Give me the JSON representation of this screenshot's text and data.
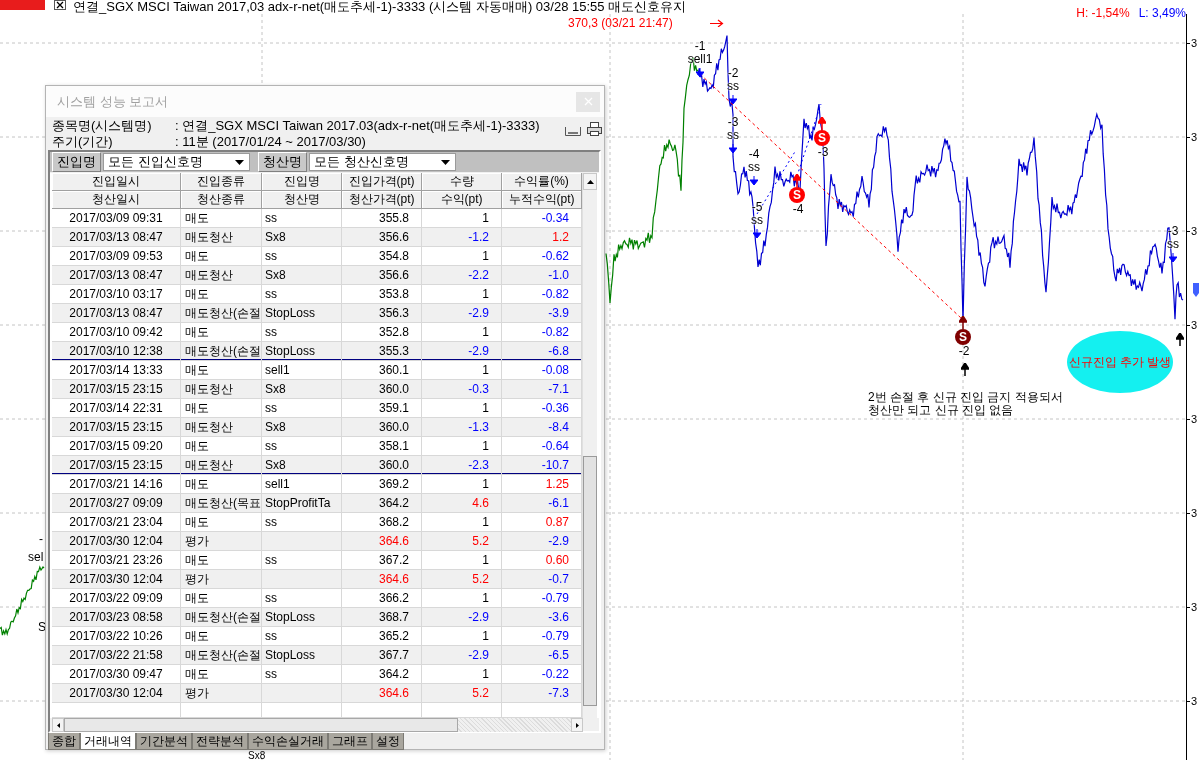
{
  "title_bar": {
    "title": "연결_SGX MSCI Taiwan 2017,03 adx-r-net(매도추세-1)-3333 (시스템 자동매매) 03/28 15:55 매도신호유지",
    "high": "H: -1,54%",
    "low": "L: 3,49%"
  },
  "chart": {
    "axis_labels": [
      "3",
      "3",
      "3",
      "3",
      "3",
      "3",
      "3",
      "3"
    ],
    "peak_label": "370,3 (03/21 21:47)",
    "entry_markers": [
      {
        "order": "-1",
        "signal": "sell1"
      },
      {
        "order": "-2",
        "signal": "ss"
      },
      {
        "order": "-3",
        "signal": "ss"
      },
      {
        "order": "-4",
        "signal": "ss"
      },
      {
        "order": "-5",
        "signal": "ss"
      },
      {
        "order": "-3",
        "signal": "ss"
      }
    ],
    "exit_markers": [
      {
        "symbol": "S",
        "order": "-4",
        "color": "#ff0000"
      },
      {
        "symbol": "S",
        "order": "-3",
        "color": "#ff0000"
      },
      {
        "symbol": "S",
        "order": "-2",
        "color": "#800000"
      }
    ],
    "cut_labels": [
      "-",
      "sel",
      "S",
      "Sx8"
    ],
    "note": "2번 손절 후 신규 진입 금지 적용되서\n청산만 되고 신규 진입 없음",
    "callout": "신규진입 추가 발생"
  },
  "report": {
    "title": "시스템 성능 보고서",
    "info": [
      {
        "label": "종목명(시스템명)",
        "value": ": 연결_SGX MSCI Taiwan 2017.03(adx-r-net(매도추세-1)-3333)"
      },
      {
        "label": "주기(기간)",
        "value": ": 11분 (2017/01/24 ~ 2017/03/30)"
      }
    ],
    "filters": [
      {
        "label": "진입명",
        "value": "모든 진입신호명"
      },
      {
        "label": "청산명",
        "value": "모든 청산신호명"
      }
    ],
    "header_rows": [
      [
        "진입일시",
        "진입종류",
        "진입명",
        "진입가격(pt)",
        "수량",
        "수익률(%)"
      ],
      [
        "청산일시",
        "청산종류",
        "청산명",
        "청산가격(pt)",
        "수익(pt)",
        "누적수익(pt)"
      ]
    ],
    "rows": [
      {
        "kind": "entry",
        "group_end": false,
        "time": "2017/03/09 09:31",
        "type": "매도",
        "signal": "ss",
        "price": "355.8",
        "amount": "1",
        "rate": {
          "text": "-0.34",
          "color": "#0000ff"
        }
      },
      {
        "kind": "exit",
        "group_end": false,
        "time": "2017/03/13 08:47",
        "type": "매도청산",
        "signal": "Sx8",
        "price": "356.6",
        "amount": {
          "text": "-1.2",
          "color": "#0000ff"
        },
        "rate": {
          "text": "1.2",
          "color": "#ff0000"
        }
      },
      {
        "kind": "entry",
        "group_end": false,
        "time": "2017/03/09 09:53",
        "type": "매도",
        "signal": "ss",
        "price": "354.8",
        "amount": "1",
        "rate": {
          "text": "-0.62",
          "color": "#0000ff"
        }
      },
      {
        "kind": "exit",
        "group_end": false,
        "time": "2017/03/13 08:47",
        "type": "매도청산",
        "signal": "Sx8",
        "price": "356.6",
        "amount": {
          "text": "-2.2",
          "color": "#0000ff"
        },
        "rate": {
          "text": "-1.0",
          "color": "#0000ff"
        }
      },
      {
        "kind": "entry",
        "group_end": false,
        "time": "2017/03/10 03:17",
        "type": "매도",
        "signal": "ss",
        "price": "353.8",
        "amount": "1",
        "rate": {
          "text": "-0.82",
          "color": "#0000ff"
        }
      },
      {
        "kind": "exit",
        "group_end": false,
        "time": "2017/03/13 08:47",
        "type": "매도청산(손절",
        "signal": "StopLoss",
        "price": "356.3",
        "amount": {
          "text": "-2.9",
          "color": "#0000ff"
        },
        "rate": {
          "text": "-3.9",
          "color": "#0000ff"
        }
      },
      {
        "kind": "entry",
        "group_end": false,
        "time": "2017/03/10 09:42",
        "type": "매도",
        "signal": "ss",
        "price": "352.8",
        "amount": "1",
        "rate": {
          "text": "-0.82",
          "color": "#0000ff"
        }
      },
      {
        "kind": "exit",
        "group_end": true,
        "time": "2017/03/10 12:38",
        "type": "매도청산(손절",
        "signal": "StopLoss",
        "price": "355.3",
        "amount": {
          "text": "-2.9",
          "color": "#0000ff"
        },
        "rate": {
          "text": "-6.8",
          "color": "#0000ff"
        }
      },
      {
        "kind": "entry",
        "group_end": false,
        "time": "2017/03/14 13:33",
        "type": "매도",
        "signal": "sell1",
        "price": "360.1",
        "amount": "1",
        "rate": {
          "text": "-0.08",
          "color": "#0000ff"
        }
      },
      {
        "kind": "exit",
        "group_end": false,
        "time": "2017/03/15 23:15",
        "type": "매도청산",
        "signal": "Sx8",
        "price": "360.0",
        "amount": {
          "text": "-0.3",
          "color": "#0000ff"
        },
        "rate": {
          "text": "-7.1",
          "color": "#0000ff"
        }
      },
      {
        "kind": "entry",
        "group_end": false,
        "time": "2017/03/14 22:31",
        "type": "매도",
        "signal": "ss",
        "price": "359.1",
        "amount": "1",
        "rate": {
          "text": "-0.36",
          "color": "#0000ff"
        }
      },
      {
        "kind": "exit",
        "group_end": false,
        "time": "2017/03/15 23:15",
        "type": "매도청산",
        "signal": "Sx8",
        "price": "360.0",
        "amount": {
          "text": "-1.3",
          "color": "#0000ff"
        },
        "rate": {
          "text": "-8.4",
          "color": "#0000ff"
        }
      },
      {
        "kind": "entry",
        "group_end": false,
        "time": "2017/03/15 09:20",
        "type": "매도",
        "signal": "ss",
        "price": "358.1",
        "amount": "1",
        "rate": {
          "text": "-0.64",
          "color": "#0000ff"
        }
      },
      {
        "kind": "exit",
        "group_end": true,
        "time": "2017/03/15 23:15",
        "type": "매도청산",
        "signal": "Sx8",
        "price": "360.0",
        "amount": {
          "text": "-2.3",
          "color": "#0000ff"
        },
        "rate": {
          "text": "-10.7",
          "color": "#0000ff"
        }
      },
      {
        "kind": "entry",
        "group_end": false,
        "time": "2017/03/21 14:16",
        "type": "매도",
        "signal": "sell1",
        "price": "369.2",
        "amount": "1",
        "rate": {
          "text": "1.25",
          "color": "#ff0000"
        }
      },
      {
        "kind": "exit",
        "group_end": false,
        "time": "2017/03/27 09:09",
        "type": "매도청산(목표",
        "signal": "StopProfitTa",
        "price": "364.2",
        "amount": {
          "text": "4.6",
          "color": "#ff0000"
        },
        "rate": {
          "text": "-6.1",
          "color": "#0000ff"
        }
      },
      {
        "kind": "entry",
        "group_end": false,
        "time": "2017/03/21 23:04",
        "type": "매도",
        "signal": "ss",
        "price": "368.2",
        "amount": "1",
        "rate": {
          "text": "0.87",
          "color": "#ff0000"
        }
      },
      {
        "kind": "valuation",
        "group_end": false,
        "time": "2017/03/30 12:04",
        "type": "평가",
        "price": {
          "text": "364.6",
          "color": "#ff0000"
        },
        "amount": {
          "text": "5.2",
          "color": "#ff0000"
        },
        "rate": {
          "text": "-2.9",
          "color": "#0000ff"
        }
      },
      {
        "kind": "entry",
        "group_end": false,
        "time": "2017/03/21 23:26",
        "type": "매도",
        "signal": "ss",
        "price": "367.2",
        "amount": "1",
        "rate": {
          "text": "0.60",
          "color": "#ff0000"
        }
      },
      {
        "kind": "valuation",
        "group_end": false,
        "time": "2017/03/30 12:04",
        "type": "평가",
        "price": {
          "text": "364.6",
          "color": "#ff0000"
        },
        "amount": {
          "text": "5.2",
          "color": "#ff0000"
        },
        "rate": {
          "text": "-0.7",
          "color": "#0000ff"
        }
      },
      {
        "kind": "entry",
        "group_end": false,
        "time": "2017/03/22 09:09",
        "type": "매도",
        "signal": "ss",
        "price": "366.2",
        "amount": "1",
        "rate": {
          "text": "-0.79",
          "color": "#0000ff"
        }
      },
      {
        "kind": "exit",
        "group_end": false,
        "time": "2017/03/23 08:58",
        "type": "매도청산(손절",
        "signal": "StopLoss",
        "price": "368.7",
        "amount": {
          "text": "-2.9",
          "color": "#0000ff"
        },
        "rate": {
          "text": "-3.6",
          "color": "#0000ff"
        }
      },
      {
        "kind": "entry",
        "group_end": false,
        "time": "2017/03/22 10:26",
        "type": "매도",
        "signal": "ss",
        "price": "365.2",
        "amount": "1",
        "rate": {
          "text": "-0.79",
          "color": "#0000ff"
        }
      },
      {
        "kind": "exit",
        "group_end": false,
        "time": "2017/03/22 21:58",
        "type": "매도청산(손절",
        "signal": "StopLoss",
        "price": "367.7",
        "amount": {
          "text": "-2.9",
          "color": "#0000ff"
        },
        "rate": {
          "text": "-6.5",
          "color": "#0000ff"
        }
      },
      {
        "kind": "entry",
        "group_end": false,
        "time": "2017/03/30 09:47",
        "type": "매도",
        "signal": "ss",
        "price": "364.2",
        "amount": "1",
        "rate": {
          "text": "-0.22",
          "color": "#0000ff"
        }
      },
      {
        "kind": "valuation",
        "group_end": false,
        "time": "2017/03/30 12:04",
        "type": "평가",
        "price": {
          "text": "364.6",
          "color": "#ff0000"
        },
        "amount": {
          "text": "5.2",
          "color": "#ff0000"
        },
        "rate": {
          "text": "-7.3",
          "color": "#0000ff"
        }
      }
    ],
    "tabs": [
      {
        "label": "종합",
        "selected": false
      },
      {
        "label": "거래내역",
        "selected": true
      },
      {
        "label": "기간분석",
        "selected": false
      },
      {
        "label": "전략분석",
        "selected": false
      },
      {
        "label": "수익손실거래",
        "selected": false
      },
      {
        "label": "그래프",
        "selected": false
      },
      {
        "label": "설정",
        "selected": false
      }
    ]
  }
}
